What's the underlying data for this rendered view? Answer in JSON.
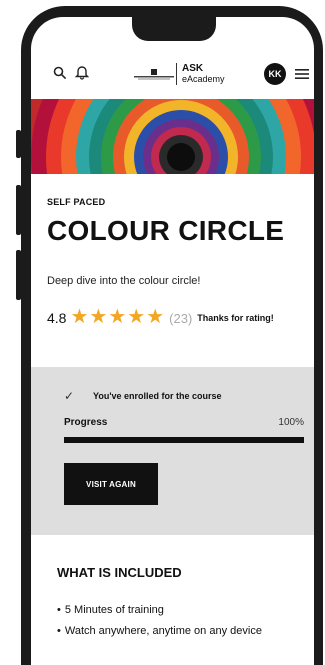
{
  "header": {
    "logo_brand": "Schwarzkopf",
    "logo_line1": "ASK",
    "logo_line2": "eAcademy",
    "avatar_initials": "KK",
    "icons": [
      "search-icon",
      "bell-icon",
      "menu-icon"
    ]
  },
  "course": {
    "tag": "SELF PACED",
    "title": "COLOUR CIRCLE",
    "subtitle": "Deep dive into the colour circle!",
    "rating_value": "4.8",
    "stars": 5,
    "rating_count": "(23)",
    "rating_message": "Thanks for rating!"
  },
  "enrollment": {
    "status_text": "You've enrolled for the course",
    "progress_label": "Progress",
    "progress_pct": "100%",
    "progress_value": 1.0,
    "button_label": "VISIT AGAIN"
  },
  "included": {
    "title": "WHAT IS INCLUDED",
    "items": [
      "5 Minutes of training",
      "Watch anywhere, anytime on any device"
    ]
  },
  "colors": {
    "star": "#f4a623",
    "button_bg": "#111111",
    "panel_bg": "#dedede"
  }
}
